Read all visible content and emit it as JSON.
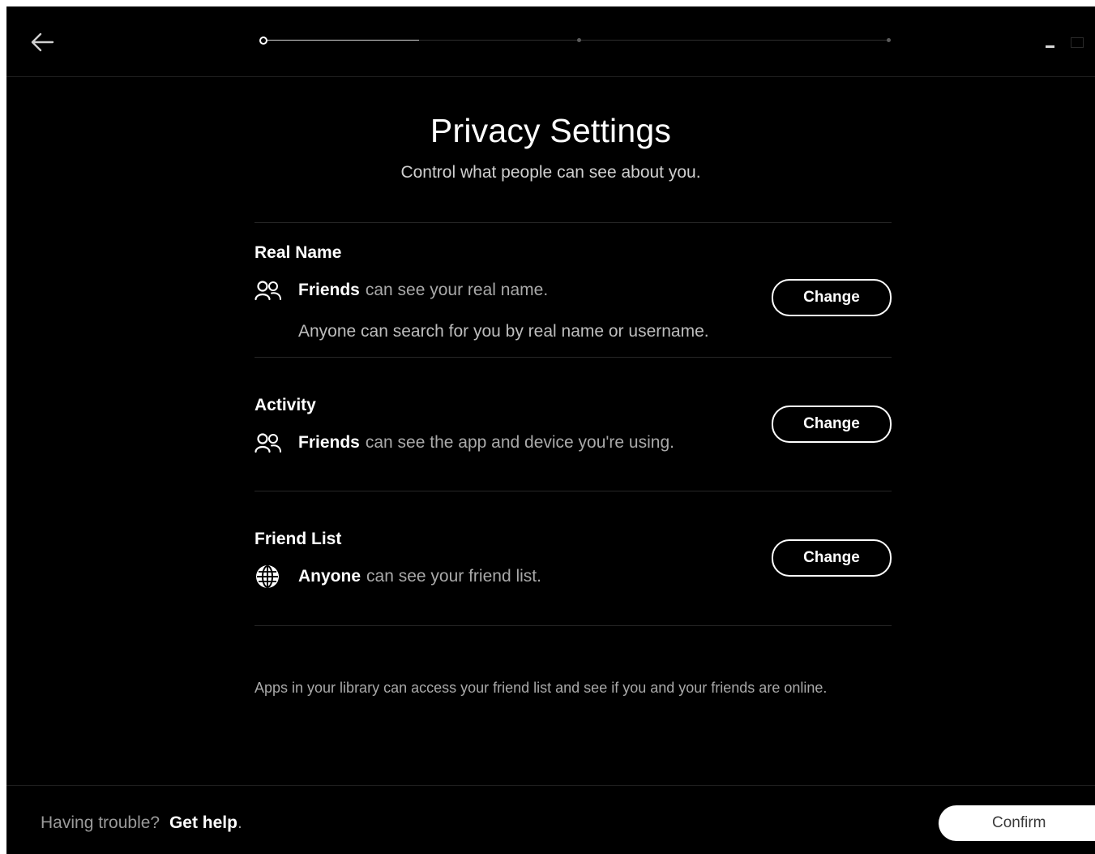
{
  "header": {
    "back_icon": "arrow-left-icon",
    "progress": {
      "steps": 3,
      "current_step": 1,
      "fill_fraction": 0.25
    },
    "window_controls": [
      "minimize-icon",
      "maximize-icon"
    ]
  },
  "page": {
    "title": "Privacy Settings",
    "subtitle": "Control what people can see about you."
  },
  "sections": [
    {
      "title": "Real Name",
      "icon": "friends-icon",
      "audience": "Friends",
      "description": "can see your real name.",
      "extra": "Anyone can search for you by real name or username.",
      "button_label": "Change"
    },
    {
      "title": "Activity",
      "icon": "friends-icon",
      "audience": "Friends",
      "description": "can see the app and device you're using.",
      "button_label": "Change"
    },
    {
      "title": "Friend List",
      "icon": "globe-icon",
      "audience": "Anyone",
      "description": "can see your friend list.",
      "button_label": "Change"
    }
  ],
  "footnote": "Apps in your library can access your friend list and see if you and your friends are online.",
  "footer": {
    "help_prefix": "Having trouble?",
    "help_link": "Get help",
    "help_suffix": ".",
    "confirm_label": "Confirm"
  },
  "colors": {
    "background": "#000000",
    "text_primary": "#ffffff",
    "text_secondary": "#a9a9a9",
    "divider": "#262626"
  }
}
